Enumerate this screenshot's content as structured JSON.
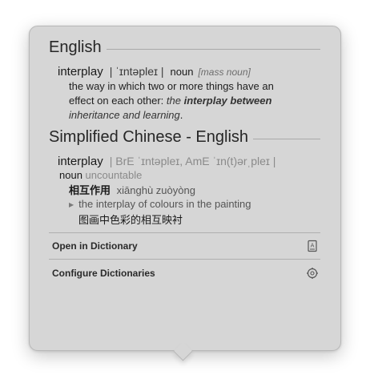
{
  "english_section": {
    "title": "English",
    "headword": "interplay",
    "pronunciation": "| ˈɪntəpleɪ |",
    "part_of_speech": "noun",
    "grammar": "[mass noun]",
    "definition_1": "the way in which two or more things have an",
    "definition_2_plain": "effect on each other: ",
    "definition_2_example": "the ",
    "definition_2_bold": "interplay between",
    "definition_3_example": "inheritance and learning",
    "definition_3_end": "."
  },
  "chinese_section": {
    "title": "Simplified Chinese - English",
    "headword": "interplay",
    "pronunciation": "| BrE ˈɪntəpleɪ,  AmE ˈɪn(t)ərˌpleɪ |",
    "part_of_speech": "noun",
    "grammar": "uncountable",
    "translation": "相互作用",
    "pinyin": "xiānghù zuòyòng",
    "example_en": "the interplay of colours in the painting",
    "example_cn": "图画中色彩的相互映衬"
  },
  "actions": {
    "open_dictionary": "Open in Dictionary",
    "configure": "Configure Dictionaries"
  },
  "icons": {
    "dictionary": "dictionary-book-icon",
    "settings": "gear-icon"
  }
}
